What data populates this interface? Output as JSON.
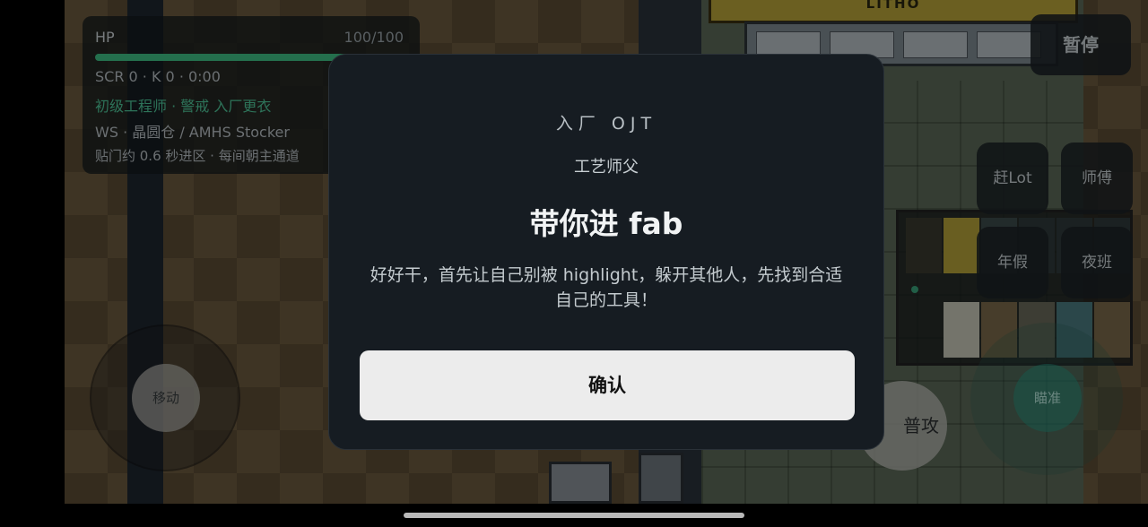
{
  "hud": {
    "hp_label": "HP",
    "hp_value": "100/100",
    "hp_fraction": 1.0,
    "stats_line": "SCR 0 · K 0 · 0:00",
    "role_line": "初级工程师 · 警戒 入厂更衣",
    "location_line": "WS · 晶圆仓 / AMHS Stocker",
    "hint_line": "贴门约 0.6 秒进区 · 每间朝主通道"
  },
  "map": {
    "litho_label": "LITHO"
  },
  "controls": {
    "pause": "暂停",
    "skill_rush_lot": "赶Lot",
    "skill_master": "师傅",
    "skill_leave": "年假",
    "skill_night_shift": "夜班",
    "move": "移动",
    "attack": "普攻",
    "aim": "瞄准"
  },
  "dialog": {
    "eyebrow": "入厂 OJT",
    "speaker": "工艺师父",
    "title": "带你进 fab",
    "body": "好好干，首先让自己别被 highlight，躲开其他人，先找到合适自己的工具！",
    "confirm": "确认"
  },
  "colors": {
    "hp_bar": "#3fbf86",
    "role_text": "#4fc79a",
    "dialog_bg": "#161c22",
    "confirm_bg": "#ececec"
  }
}
